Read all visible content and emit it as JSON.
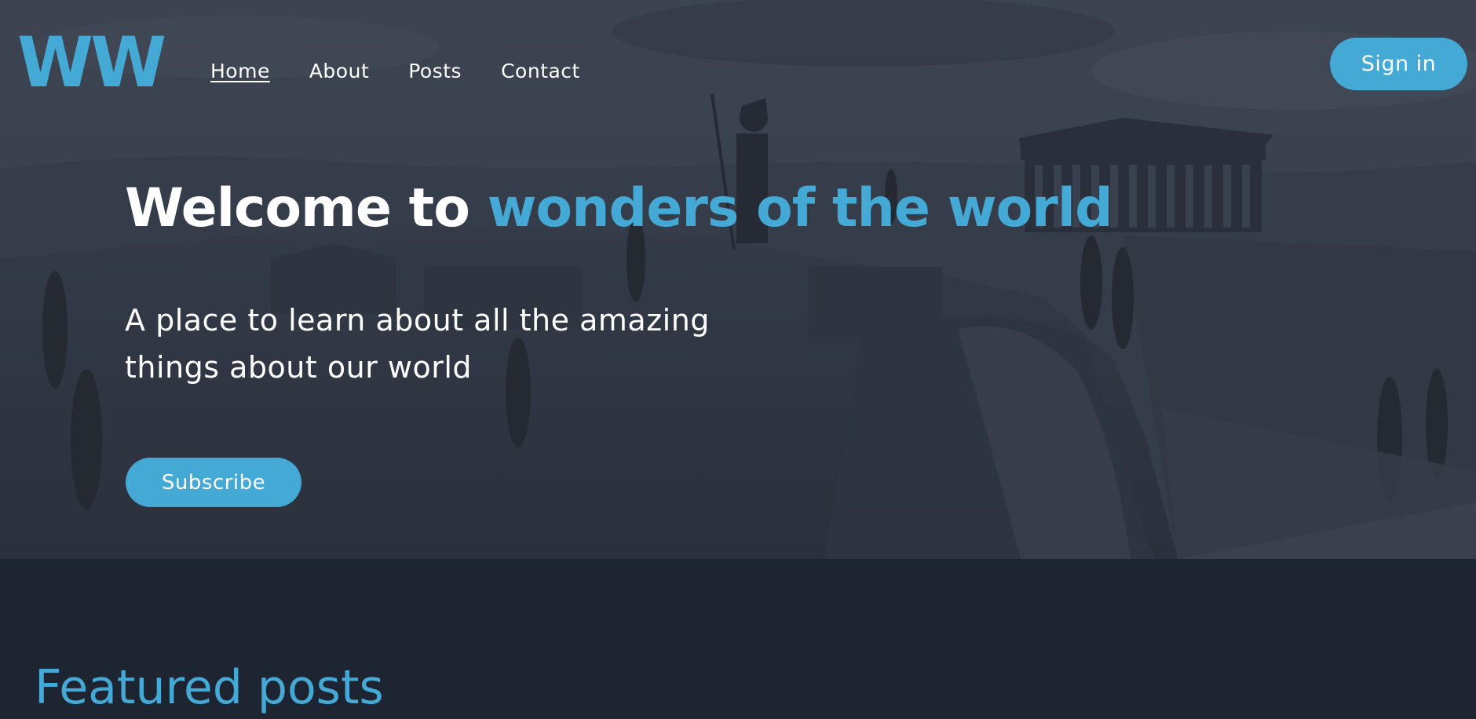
{
  "brand": {
    "logo_text": "WW",
    "accent_color": "#45a9d6",
    "background_color": "#1e2532"
  },
  "nav": {
    "items": [
      {
        "label": "Home",
        "active": true
      },
      {
        "label": "About",
        "active": false
      },
      {
        "label": "Posts",
        "active": false
      },
      {
        "label": "Contact",
        "active": false
      }
    ],
    "sign_in_label": "Sign in"
  },
  "hero": {
    "headline_prefix": "Welcome to",
    "headline_accent": "wonders of the world",
    "subtitle": "A place to learn about all the amazing things about our world",
    "subscribe_label": "Subscribe",
    "background_image": "acropolis-landscape"
  },
  "featured": {
    "title": "Featured posts"
  }
}
